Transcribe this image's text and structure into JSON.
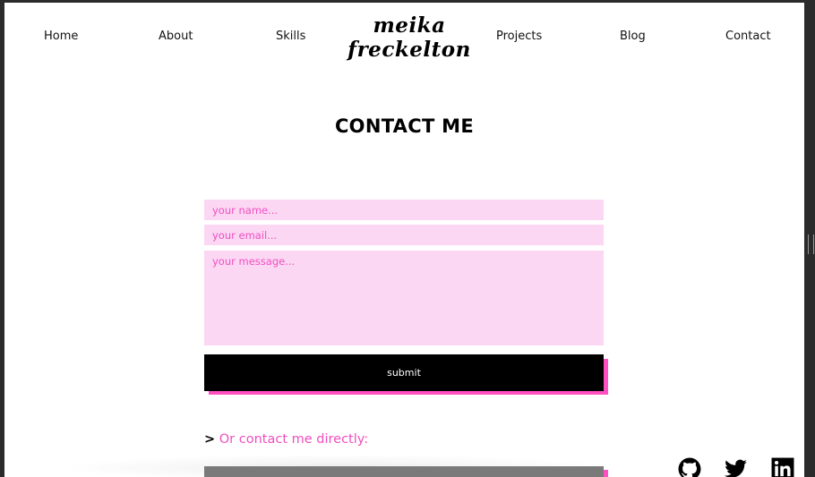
{
  "nav": {
    "home": "Home",
    "about": "About",
    "skills": "Skills",
    "projects": "Projects",
    "blog": "Blog",
    "contact": "Contact"
  },
  "logo": {
    "line1": "meika",
    "line2": "freckelton"
  },
  "contact": {
    "title": "CONTACT ME",
    "name_placeholder": "your name...",
    "email_placeholder": "your email...",
    "message_placeholder": "your message...",
    "submit_label": "submit"
  },
  "direct": {
    "arrow": ">",
    "text": "Or contact me directly:"
  },
  "social": [
    "github-icon",
    "twitter-icon",
    "linkedin-icon"
  ],
  "colors": {
    "accent": "#f04fbf",
    "field_bg": "#fcd7f4",
    "shadow_pink": "#ff4fc0",
    "button_bg": "#000000"
  }
}
